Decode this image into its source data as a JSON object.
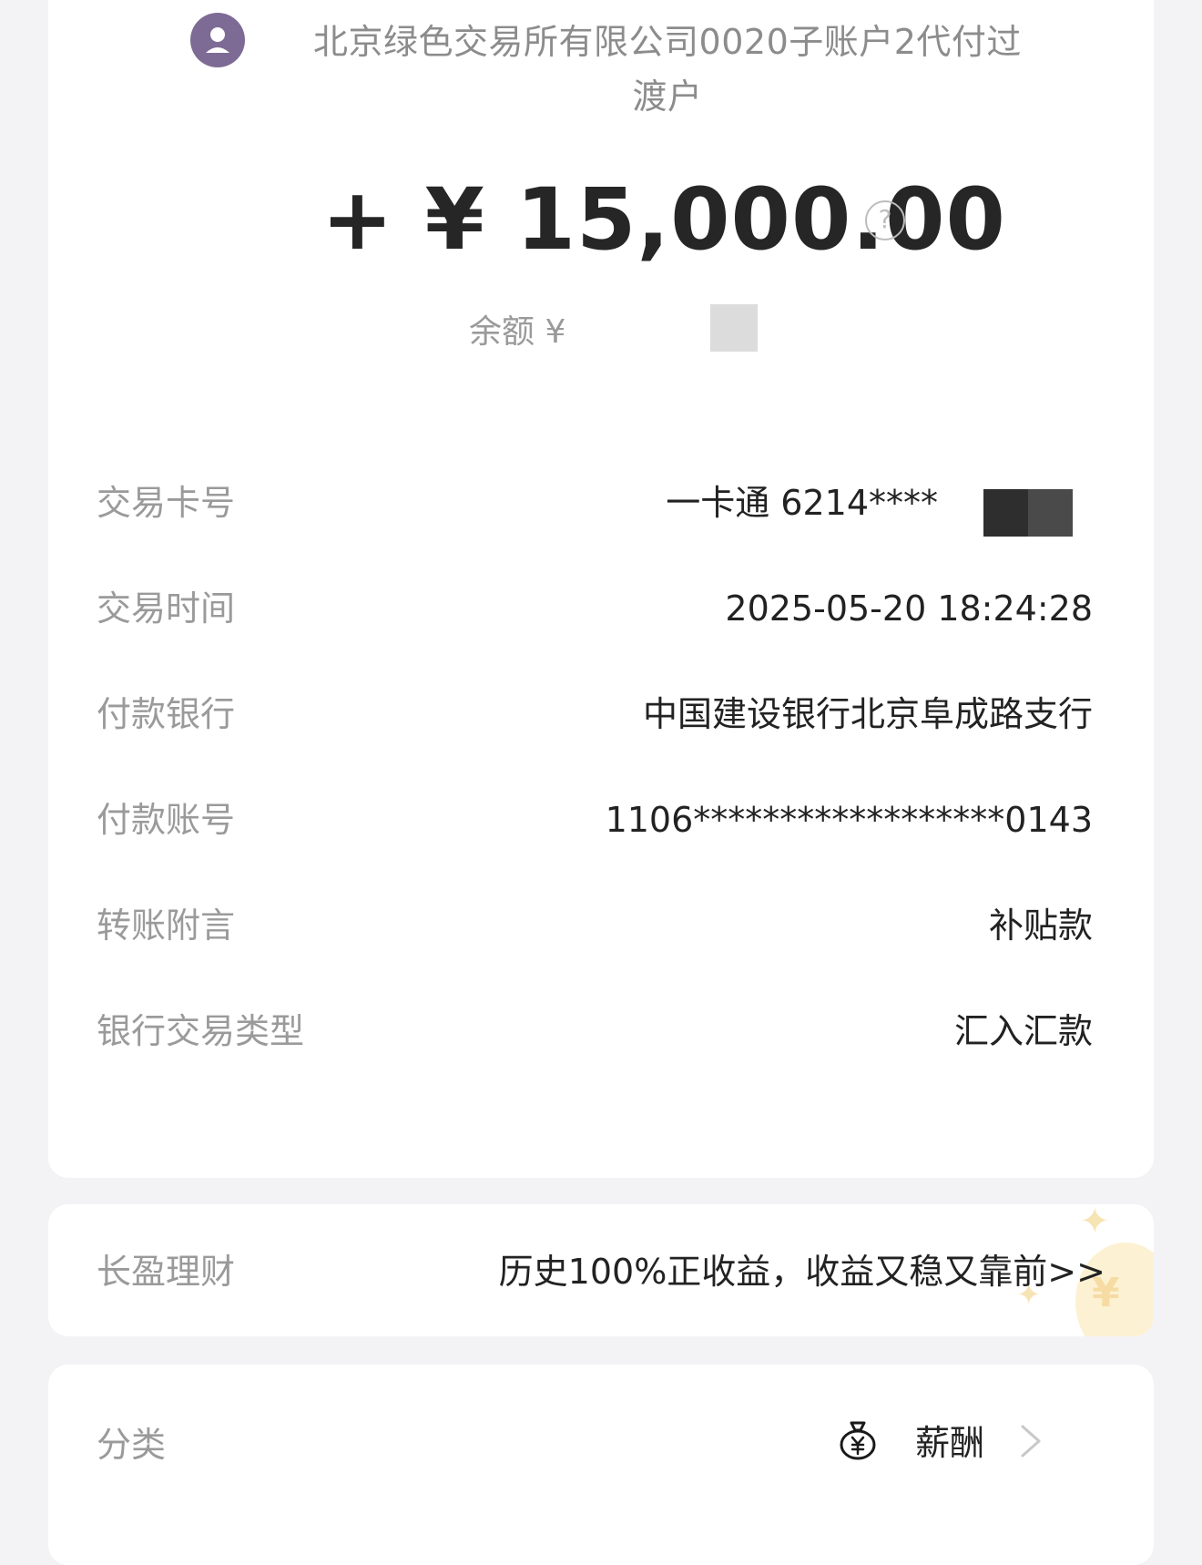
{
  "merchant": {
    "name_line1": "北京绿色交易所有限公司0020子账户2代付过",
    "name_line2": "渡户"
  },
  "amount": "+ ¥ 15,000.00",
  "balance_label": "余额 ¥ ",
  "details": [
    {
      "label": "交易卡号",
      "value": "一卡通 6214****"
    },
    {
      "label": "交易时间",
      "value": "2025-05-20 18:24:28"
    },
    {
      "label": "付款银行",
      "value": "中国建设银行北京阜成路支行"
    },
    {
      "label": "付款账号",
      "value": "1106******************0143"
    },
    {
      "label": "转账附言",
      "value": "补贴款"
    },
    {
      "label": "银行交易类型",
      "value": "汇入汇款"
    }
  ],
  "promo": {
    "label": "长盈理财",
    "text": "历史100%正收益，收益又稳又靠前>>"
  },
  "category": {
    "label": "分类",
    "value": "薪酬"
  },
  "icons": {
    "avatar": "user-avatar-icon",
    "help": "question-circle-icon",
    "category": "money-bag-icon",
    "chevron": "chevron-right-icon"
  },
  "colors": {
    "avatar": "#7d6b95",
    "label": "#9a9a9a",
    "value": "#222222"
  }
}
